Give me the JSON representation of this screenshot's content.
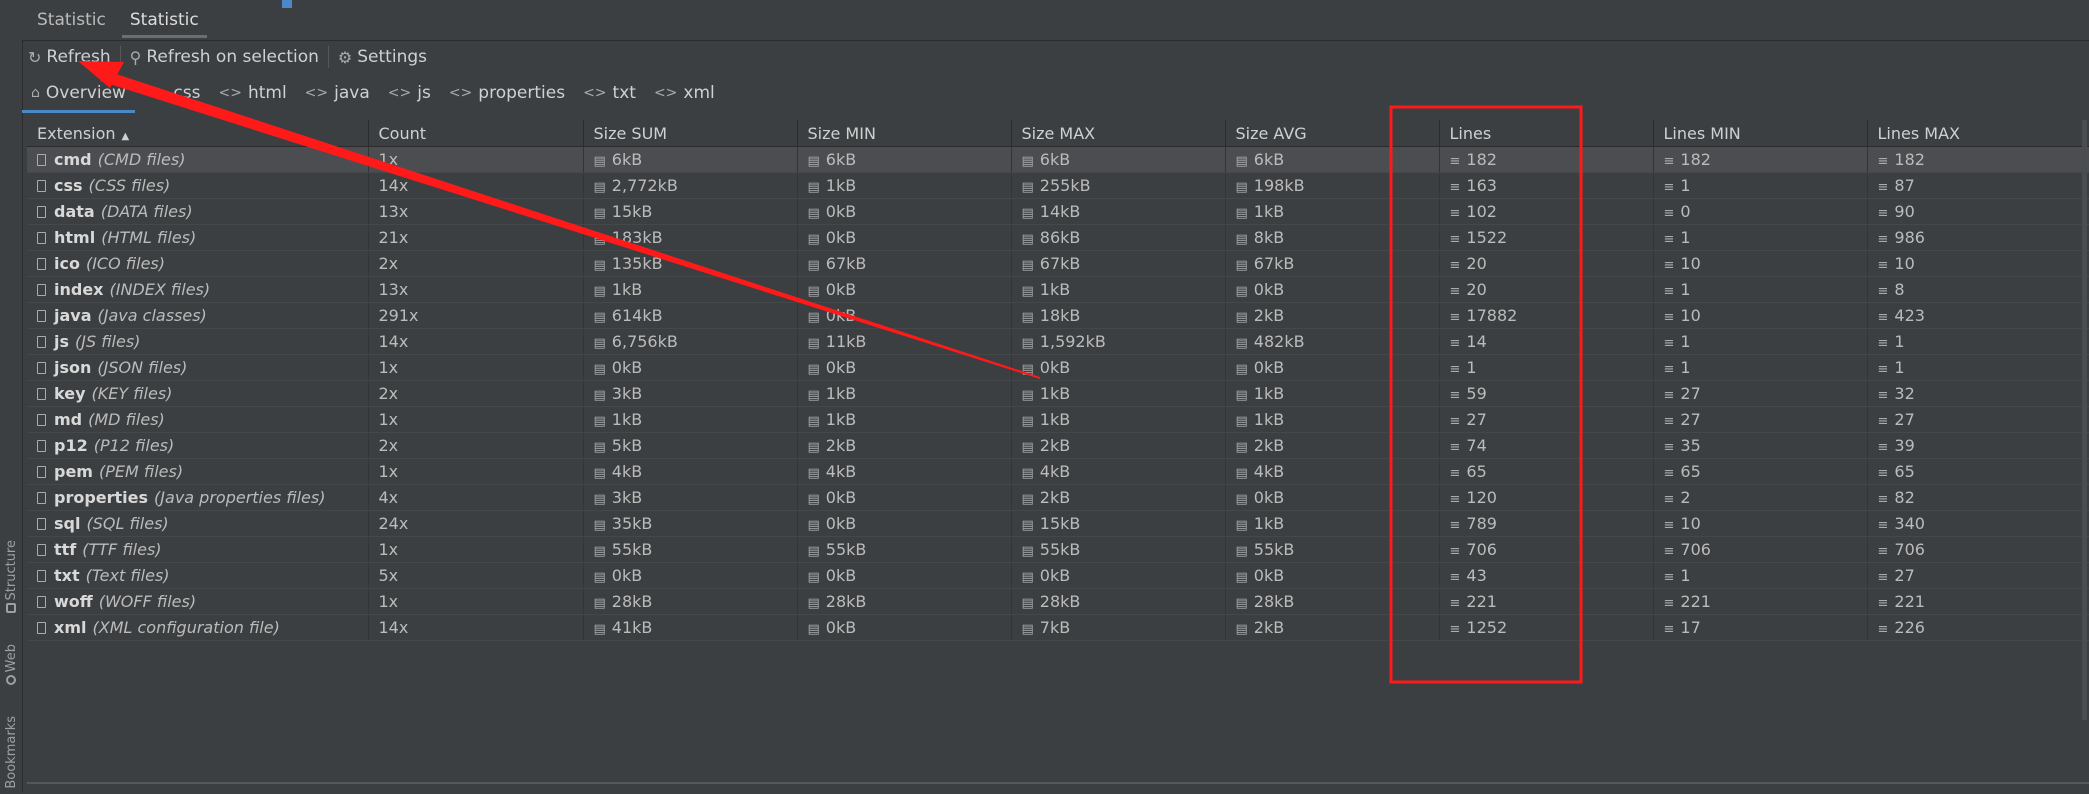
{
  "side_stripe": [
    {
      "label": "Structure",
      "icon": "structure-icon"
    },
    {
      "label": "Web",
      "icon": "globe-icon"
    },
    {
      "label": "Bookmarks",
      "icon": "bookmark-icon"
    }
  ],
  "top_tabs": [
    {
      "label": "Statistic",
      "active": false
    },
    {
      "label": "Statistic",
      "active": true
    }
  ],
  "toolbar": {
    "refresh": "Refresh",
    "refresh_selection": "Refresh on selection",
    "settings": "Settings"
  },
  "content_tabs": [
    {
      "label": "Overview",
      "icon": "home-icon",
      "active": true
    },
    {
      "label": "css",
      "icon": "code-icon"
    },
    {
      "label": "html",
      "icon": "code-icon"
    },
    {
      "label": "java",
      "icon": "code-icon"
    },
    {
      "label": "js",
      "icon": "code-icon"
    },
    {
      "label": "properties",
      "icon": "code-icon"
    },
    {
      "label": "txt",
      "icon": "code-icon"
    },
    {
      "label": "xml",
      "icon": "code-icon"
    }
  ],
  "table": {
    "columns": [
      "Extension",
      "Count",
      "Size SUM",
      "Size MIN",
      "Size MAX",
      "Size AVG",
      "Lines",
      "Lines MIN",
      "Lines MAX"
    ],
    "sorted_column": "Extension",
    "rows": [
      {
        "ext": "cmd",
        "desc": "(CMD files)",
        "count": "1x",
        "size_sum": "6kB",
        "size_min": "6kB",
        "size_max": "6kB",
        "size_avg": "6kB",
        "lines": "182",
        "lines_min": "182",
        "lines_max": "182"
      },
      {
        "ext": "css",
        "desc": "(CSS files)",
        "count": "14x",
        "size_sum": "2,772kB",
        "size_min": "1kB",
        "size_max": "255kB",
        "size_avg": "198kB",
        "lines": "163",
        "lines_min": "1",
        "lines_max": "87"
      },
      {
        "ext": "data",
        "desc": "(DATA files)",
        "count": "13x",
        "size_sum": "15kB",
        "size_min": "0kB",
        "size_max": "14kB",
        "size_avg": "1kB",
        "lines": "102",
        "lines_min": "0",
        "lines_max": "90"
      },
      {
        "ext": "html",
        "desc": "(HTML files)",
        "count": "21x",
        "size_sum": "183kB",
        "size_min": "0kB",
        "size_max": "86kB",
        "size_avg": "8kB",
        "lines": "1522",
        "lines_min": "1",
        "lines_max": "986"
      },
      {
        "ext": "ico",
        "desc": "(ICO files)",
        "count": "2x",
        "size_sum": "135kB",
        "size_min": "67kB",
        "size_max": "67kB",
        "size_avg": "67kB",
        "lines": "20",
        "lines_min": "10",
        "lines_max": "10"
      },
      {
        "ext": "index",
        "desc": "(INDEX files)",
        "count": "13x",
        "size_sum": "1kB",
        "size_min": "0kB",
        "size_max": "1kB",
        "size_avg": "0kB",
        "lines": "20",
        "lines_min": "1",
        "lines_max": "8"
      },
      {
        "ext": "java",
        "desc": "(Java classes)",
        "count": "291x",
        "size_sum": "614kB",
        "size_min": "0kB",
        "size_max": "18kB",
        "size_avg": "2kB",
        "lines": "17882",
        "lines_min": "10",
        "lines_max": "423"
      },
      {
        "ext": "js",
        "desc": "(JS files)",
        "count": "14x",
        "size_sum": "6,756kB",
        "size_min": "11kB",
        "size_max": "1,592kB",
        "size_avg": "482kB",
        "lines": "14",
        "lines_min": "1",
        "lines_max": "1"
      },
      {
        "ext": "json",
        "desc": "(JSON files)",
        "count": "1x",
        "size_sum": "0kB",
        "size_min": "0kB",
        "size_max": "0kB",
        "size_avg": "0kB",
        "lines": "1",
        "lines_min": "1",
        "lines_max": "1"
      },
      {
        "ext": "key",
        "desc": "(KEY files)",
        "count": "2x",
        "size_sum": "3kB",
        "size_min": "1kB",
        "size_max": "1kB",
        "size_avg": "1kB",
        "lines": "59",
        "lines_min": "27",
        "lines_max": "32"
      },
      {
        "ext": "md",
        "desc": "(MD files)",
        "count": "1x",
        "size_sum": "1kB",
        "size_min": "1kB",
        "size_max": "1kB",
        "size_avg": "1kB",
        "lines": "27",
        "lines_min": "27",
        "lines_max": "27"
      },
      {
        "ext": "p12",
        "desc": "(P12 files)",
        "count": "2x",
        "size_sum": "5kB",
        "size_min": "2kB",
        "size_max": "2kB",
        "size_avg": "2kB",
        "lines": "74",
        "lines_min": "35",
        "lines_max": "39"
      },
      {
        "ext": "pem",
        "desc": "(PEM files)",
        "count": "1x",
        "size_sum": "4kB",
        "size_min": "4kB",
        "size_max": "4kB",
        "size_avg": "4kB",
        "lines": "65",
        "lines_min": "65",
        "lines_max": "65"
      },
      {
        "ext": "properties",
        "desc": "(Java properties files)",
        "count": "4x",
        "size_sum": "3kB",
        "size_min": "0kB",
        "size_max": "2kB",
        "size_avg": "0kB",
        "lines": "120",
        "lines_min": "2",
        "lines_max": "82"
      },
      {
        "ext": "sql",
        "desc": "(SQL files)",
        "count": "24x",
        "size_sum": "35kB",
        "size_min": "0kB",
        "size_max": "15kB",
        "size_avg": "1kB",
        "lines": "789",
        "lines_min": "10",
        "lines_max": "340"
      },
      {
        "ext": "ttf",
        "desc": "(TTF files)",
        "count": "1x",
        "size_sum": "55kB",
        "size_min": "55kB",
        "size_max": "55kB",
        "size_avg": "55kB",
        "lines": "706",
        "lines_min": "706",
        "lines_max": "706"
      },
      {
        "ext": "txt",
        "desc": "(Text files)",
        "count": "5x",
        "size_sum": "0kB",
        "size_min": "0kB",
        "size_max": "0kB",
        "size_avg": "0kB",
        "lines": "43",
        "lines_min": "1",
        "lines_max": "27"
      },
      {
        "ext": "woff",
        "desc": "(WOFF files)",
        "count": "1x",
        "size_sum": "28kB",
        "size_min": "28kB",
        "size_max": "28kB",
        "size_avg": "28kB",
        "lines": "221",
        "lines_min": "221",
        "lines_max": "221"
      },
      {
        "ext": "xml",
        "desc": "(XML configuration file)",
        "count": "14x",
        "size_sum": "41kB",
        "size_min": "0kB",
        "size_max": "7kB",
        "size_avg": "2kB",
        "lines": "1252",
        "lines_min": "17",
        "lines_max": "226"
      }
    ]
  },
  "annotation_color": "#ff1a1a"
}
